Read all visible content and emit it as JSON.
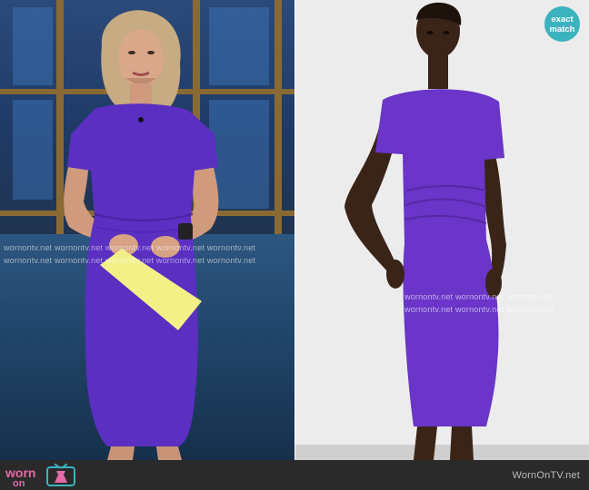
{
  "left_photo": {
    "watermark_row_1": "wornontv.net  wornontv.net  wornontv.net  wornontv.net  wornontv.net",
    "watermark_row_2": "wornontv.net  wornontv.net  wornontv.net  wornontv.net  wornontv.net",
    "dress_color": "#5a2fc2"
  },
  "right_photo": {
    "watermark_row_1": "wornontv.net  wornontv.net  wornontv.net",
    "watermark_row_2": "wornontv.net  wornontv.net  wornontv.net",
    "badge_line_1": "exact",
    "badge_line_2": "match",
    "badge_color": "#3bb3be",
    "dress_color": "#6a35c8"
  },
  "footer": {
    "logo_word_1": "worn",
    "logo_word_2": "on",
    "logo_icon": "tv-dress-icon",
    "site_name": "WornOnTV.net"
  }
}
